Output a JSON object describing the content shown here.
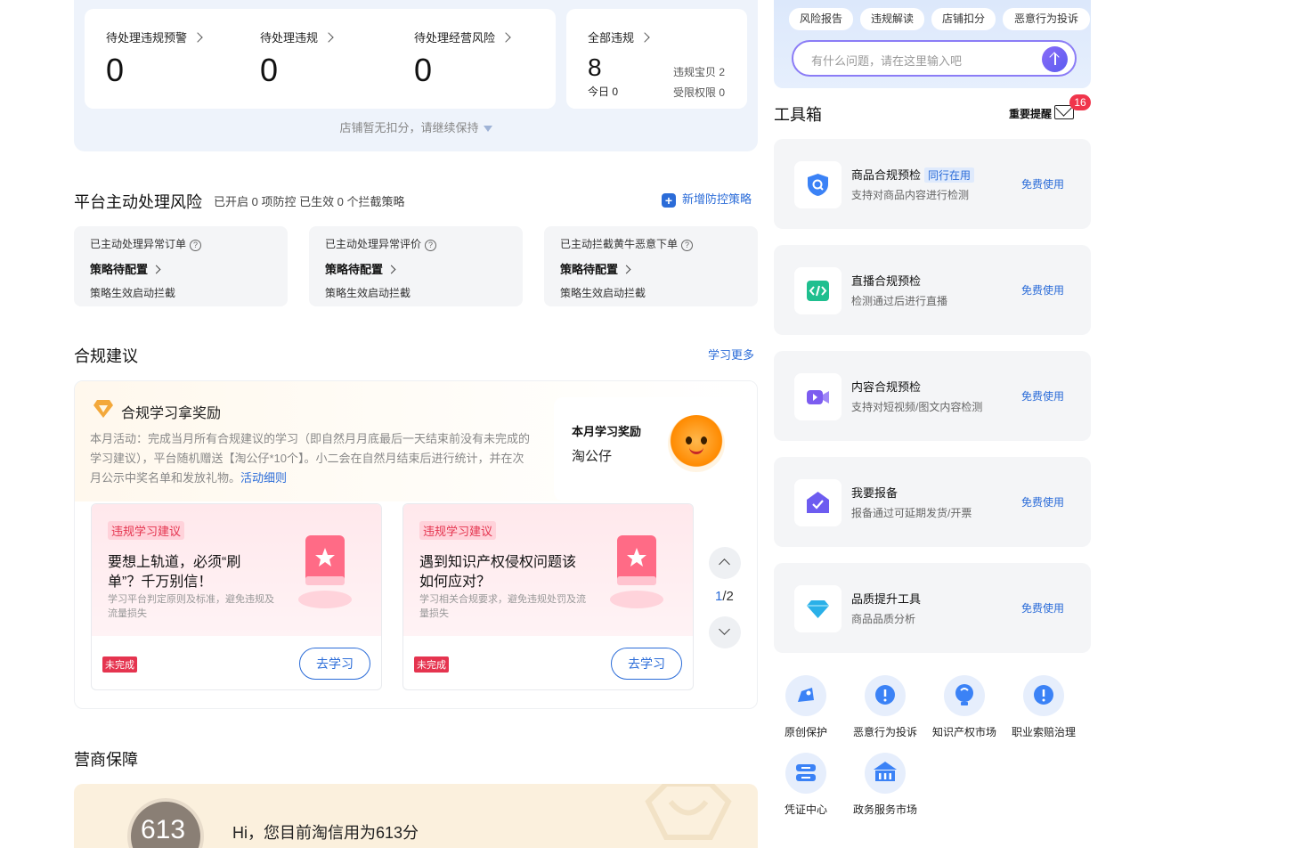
{
  "violation": {
    "items": [
      {
        "label": "待处理违规预警",
        "value": "0"
      },
      {
        "label": "待处理违规",
        "value": "0"
      },
      {
        "label": "待处理经营风险",
        "value": "0"
      }
    ],
    "all": {
      "label": "全部违规",
      "value": "8",
      "today_label": "今日",
      "today_value": "0",
      "sub1": "违规宝贝 2",
      "sub2": "受限权限 0"
    },
    "note": "店铺暂无扣分，请继续保持"
  },
  "risk": {
    "title": "平台主动处理风险",
    "summary": "已开启 0 项防控 已生效 0 个拦截策略",
    "add_link": "新增防控策略",
    "cards": [
      {
        "title": "已主动处理异常订单",
        "status": "策略待配置",
        "note": "策略生效启动拦截"
      },
      {
        "title": "已主动处理异常评价",
        "status": "策略待配置",
        "note": "策略生效启动拦截"
      },
      {
        "title": "已主动拦截黄牛恶意下单",
        "status": "策略待配置",
        "note": "策略生效启动拦截"
      }
    ]
  },
  "compliance": {
    "title": "合规建议",
    "more": "学习更多",
    "reward_title": "合规学习拿奖励",
    "reward_desc": "本月活动：完成当月所有合规建议的学习（即自然月月底最后一天结束前没有未完成的学习建议），平台随机赠送【淘公仔*10个】。小二会在自然月结束后进行统计，并在次月公示中奖名单和发放礼物。",
    "reward_link": "活动细则",
    "month_title": "本月学习奖励",
    "month_name": "淘公仔",
    "cards": [
      {
        "tag": "违规学习建议",
        "title": "要想上轨道，必须“刷单”？千万别信！",
        "desc": "学习平台判定原则及标准，避免违规及流量损失",
        "status": "未完成",
        "button": "去学习"
      },
      {
        "tag": "违规学习建议",
        "title": "遇到知识产权侵权问题该如何应对？",
        "desc": "学习相关合规要求，避免违规处罚及流量损失",
        "status": "未完成",
        "button": "去学习"
      }
    ],
    "pager_current": "1",
    "pager_total": "/2"
  },
  "credit": {
    "title": "营商保障",
    "score": "613",
    "text": "Hi，您目前淘信用为613分"
  },
  "assistant": {
    "chips": [
      "风险报告",
      "违规解读",
      "店铺扣分",
      "恶意行为投诉"
    ],
    "placeholder": "有什么问题，请在这里输入吧"
  },
  "toolbox": {
    "title": "工具箱",
    "remind_label": "重要提醒",
    "remind_count": "16",
    "tools": [
      {
        "name": "商品合规预检",
        "tag": "同行在用",
        "desc": "支持对商品内容进行检测",
        "action": "免费使用",
        "icon": "shield-search-icon",
        "color": "#3b82f6"
      },
      {
        "name": "直播合规预检",
        "tag": "",
        "desc": "检测通过后进行直播",
        "action": "免费使用",
        "icon": "code-icon",
        "color": "#1fbf8f"
      },
      {
        "name": "内容合规预检",
        "tag": "",
        "desc": "支持对短视频/图文内容检测",
        "action": "免费使用",
        "icon": "video-camera-icon",
        "color": "#7c5cf0"
      },
      {
        "name": "我要报备",
        "tag": "",
        "desc": "报备通过可延期发货/开票",
        "action": "免费使用",
        "icon": "report-check-icon",
        "color": "#6d5cf0"
      },
      {
        "name": "品质提升工具",
        "tag": "",
        "desc": "商品品质分析",
        "action": "免费使用",
        "icon": "diamond-icon",
        "color": "#2ab0e8"
      }
    ],
    "services": [
      {
        "label": "原创保护",
        "icon": "original-protect-icon"
      },
      {
        "label": "恶意行为投诉",
        "icon": "complaint-icon"
      },
      {
        "label": "知识产权市场",
        "icon": "ip-market-icon"
      },
      {
        "label": "职业索赔治理",
        "icon": "claim-governance-icon"
      },
      {
        "label": "凭证中心",
        "icon": "voucher-icon"
      },
      {
        "label": "政务服务市场",
        "icon": "government-service-icon"
      }
    ]
  }
}
